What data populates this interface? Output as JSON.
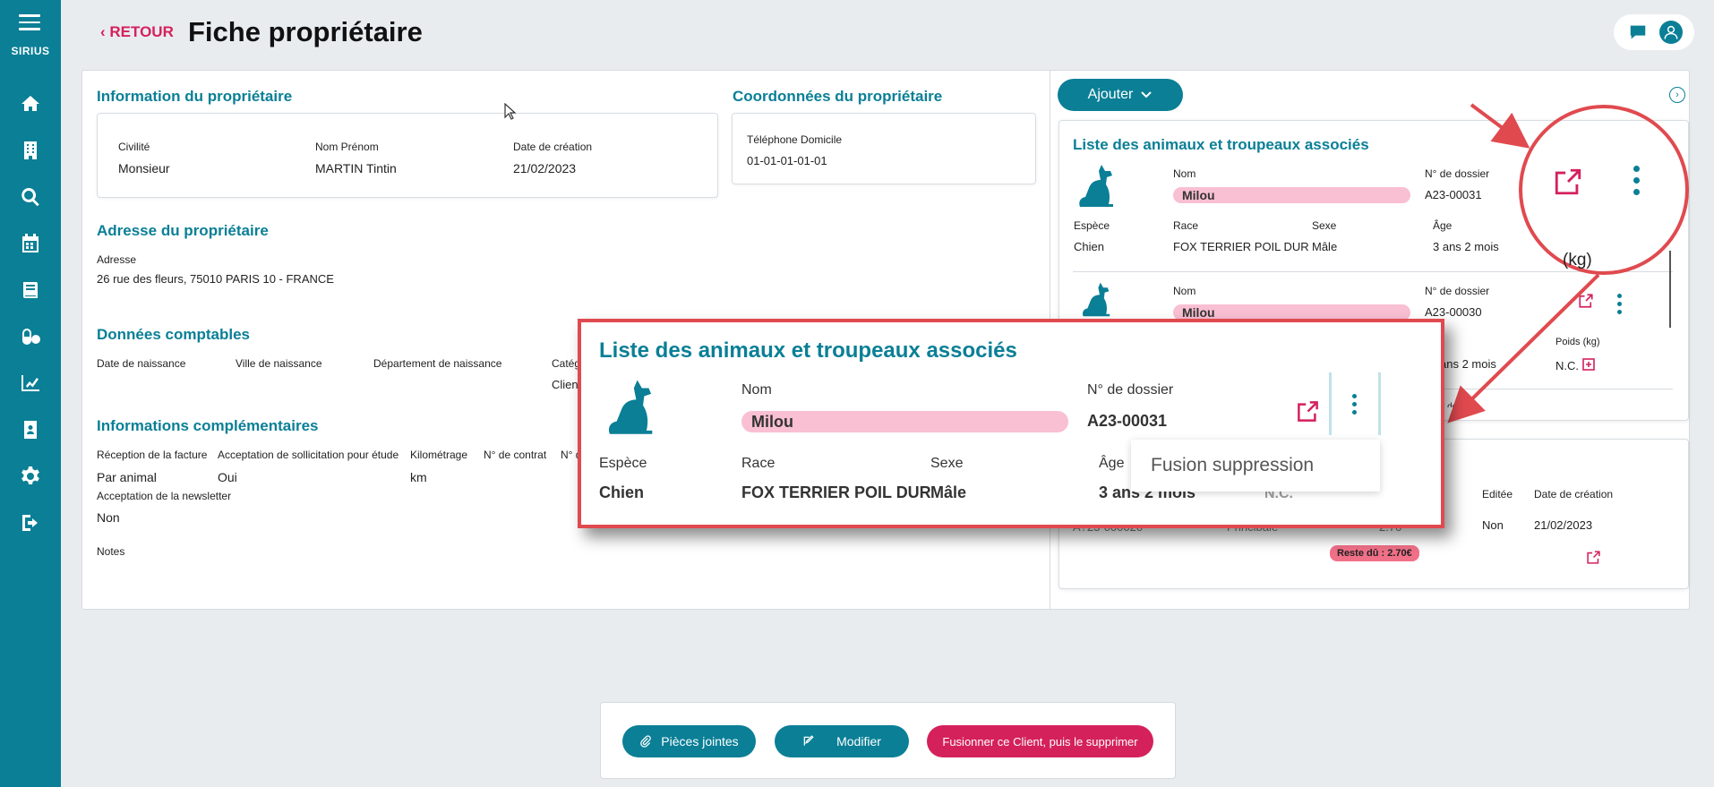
{
  "sidebar": {
    "brand": "SIRIUS",
    "items": [
      {
        "icon": "home-icon"
      },
      {
        "icon": "building-icon"
      },
      {
        "icon": "search-icon"
      },
      {
        "icon": "calendar-icon"
      },
      {
        "icon": "book-icon"
      },
      {
        "icon": "pills-icon"
      },
      {
        "icon": "chart-line-icon"
      },
      {
        "icon": "contact-book-icon"
      },
      {
        "icon": "gear-icon"
      },
      {
        "icon": "logout-icon"
      }
    ]
  },
  "header": {
    "back_label": "RETOUR",
    "title": "Fiche propriétaire"
  },
  "owner_info": {
    "title": "Information du propriétaire",
    "civilite_label": "Civilité",
    "civilite_value": "Monsieur",
    "nom_label": "Nom Prénom",
    "nom_value": "MARTIN Tintin",
    "date_label": "Date de création",
    "date_value": "21/02/2023"
  },
  "coordonnees": {
    "title": "Coordonnées du propriétaire",
    "tel_label": "Téléphone Domicile",
    "tel_value": "01-01-01-01-01"
  },
  "adresse": {
    "title": "Adresse du propriétaire",
    "label": "Adresse",
    "value": "26 rue des fleurs, 75010 PARIS 10 - FRANCE"
  },
  "comptables": {
    "title": "Données comptables",
    "labels": [
      "Date de naissance",
      "Ville de naissance",
      "Département de naissance",
      "Catég"
    ],
    "values": [
      "",
      "",
      "",
      "Clien"
    ]
  },
  "complementaires": {
    "title": "Informations complémentaires",
    "reception_label": "Réception de la facture",
    "reception_value": "Par animal",
    "acceptation_label": "Acceptation de sollicitation pour étude",
    "acceptation_value": "Oui",
    "km_label": "Kilométrage",
    "km_value": "km",
    "contrat_label": "N° de contrat",
    "nd_label": "N° d",
    "newsletter_label": "Acceptation de la newsletter",
    "newsletter_value": "Non",
    "notes_label": "Notes"
  },
  "right": {
    "ajouter_label": "Ajouter",
    "animals_title": "Liste des animaux et troupeaux associés",
    "animals": [
      {
        "nom_label": "Nom",
        "nom": "Milou",
        "dossier_label": "N° de dossier",
        "dossier": "A23-00031",
        "espece_label": "Espèce",
        "espece": "Chien",
        "race_label": "Race",
        "race": "FOX TERRIER POIL DUR",
        "sexe_label": "Sexe",
        "sexe": "Mâle",
        "age_label": "Âge",
        "age": "3 ans 2 mois"
      },
      {
        "nom_label": "Nom",
        "nom": "Milou",
        "dossier_label": "N° de dossier",
        "dossier": "A23-00030",
        "age": "ans 2 mois",
        "poids_label": "Poids (kg)",
        "poids": "N.C."
      }
    ],
    "cut_label": "r de ssier",
    "factures": {
      "editee_label": "Editée",
      "date_label": "Date de création",
      "num": "A?23-000020",
      "type": "Principale",
      "montant": "2.70",
      "editee": "Non",
      "date": "21/02/2023",
      "reste": "Reste dû : 2.70€"
    }
  },
  "zoom": {
    "title": "Liste des animaux et troupeaux associés",
    "nom_label": "Nom",
    "nom": "Milou",
    "dossier_label": "N° de dossier",
    "dossier": "A23-00031",
    "espece_label": "Espèce",
    "espece": "Chien",
    "race_label": "Race",
    "race": "FOX TERRIER POIL DUR",
    "sexe_label": "Sexe",
    "sexe": "Mâle",
    "age_label": "Âge",
    "age": "3 ans 2 mois",
    "behind": "N.C.",
    "menu_item": "Fusion suppression"
  },
  "annotation": {
    "kg_text": "(kg)"
  },
  "actions": {
    "pieces_label": "Pièces jointes",
    "modifier_label": "Modifier",
    "fusionner_label": "Fusionner ce Client, puis le supprimer"
  },
  "colors": {
    "brand": "#0a7f96",
    "accent": "#d4215c",
    "pill": "#f9bfd3",
    "annotation": "#e04a4f"
  }
}
